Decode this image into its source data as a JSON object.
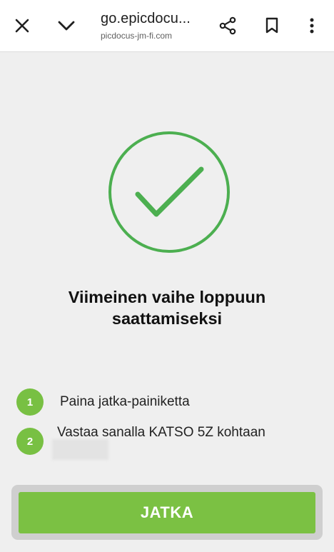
{
  "browser": {
    "url_title": "go.epicdocu...",
    "url_subtitle": "picdocus-jm-fi.com",
    "icons": [
      "close-icon",
      "chevron-down-icon",
      "share-icon",
      "bookmark-icon",
      "more-vert-icon"
    ]
  },
  "main": {
    "heading_line1": "Viimeinen vaihe loppuun",
    "heading_line2": "saattamiseksi",
    "steps": [
      {
        "number": "1",
        "text": "Paina jatka-painiketta"
      },
      {
        "number": "2",
        "text": "Vastaa sanalla KATSO 5Z kohtaan"
      }
    ],
    "cta_label": "JATKA"
  },
  "colors": {
    "accent_green": "#78c043",
    "check_green": "#4caf50",
    "background": "#efefef"
  }
}
